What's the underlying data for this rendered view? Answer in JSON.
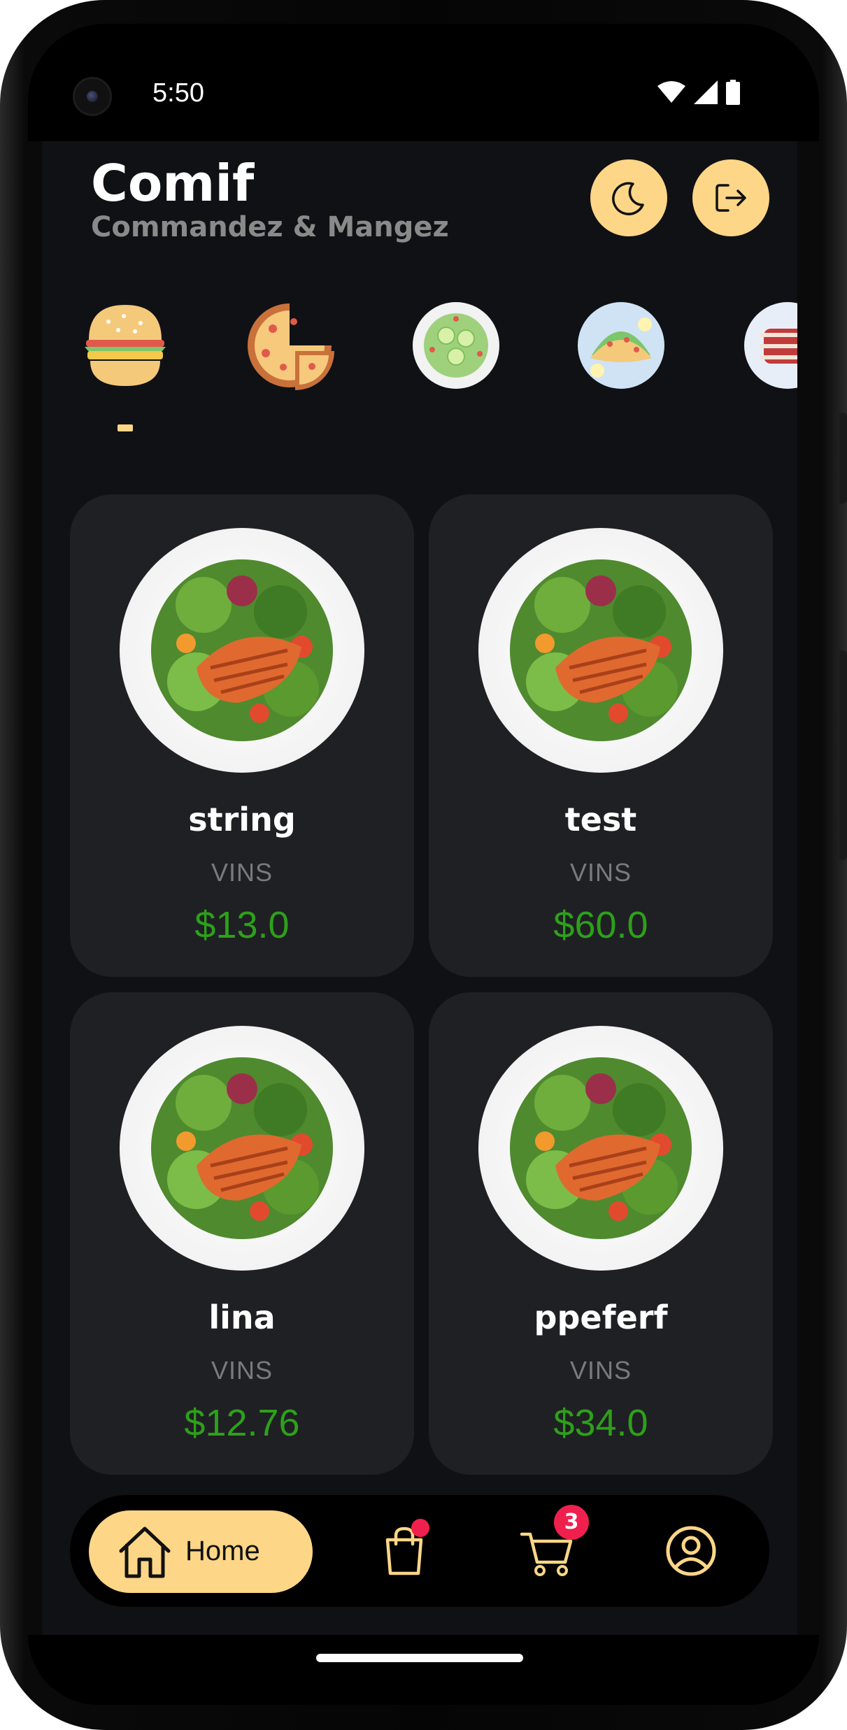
{
  "status_bar": {
    "time": "5:50"
  },
  "header": {
    "title": "Comif",
    "subtitle": "Commandez & Mangez"
  },
  "categories": [
    {
      "icon": "burger-icon"
    },
    {
      "icon": "pizza-icon"
    },
    {
      "icon": "salad-icon"
    },
    {
      "icon": "taco-icon"
    },
    {
      "icon": "ribs-icon"
    }
  ],
  "products": [
    {
      "name": "string",
      "category": "VINS",
      "price": "$13.0"
    },
    {
      "name": "test",
      "category": "VINS",
      "price": "$60.0"
    },
    {
      "name": "lina",
      "category": "VINS",
      "price": "$12.76"
    },
    {
      "name": "ppeferf",
      "category": "VINS",
      "price": "$34.0"
    }
  ],
  "nav": {
    "home_label": "Home",
    "cart_count": "3"
  },
  "colors": {
    "accent": "#fdd687",
    "price": "#2ea01a",
    "card": "#1f2024",
    "background": "#101114",
    "badge": "#f0204e"
  }
}
